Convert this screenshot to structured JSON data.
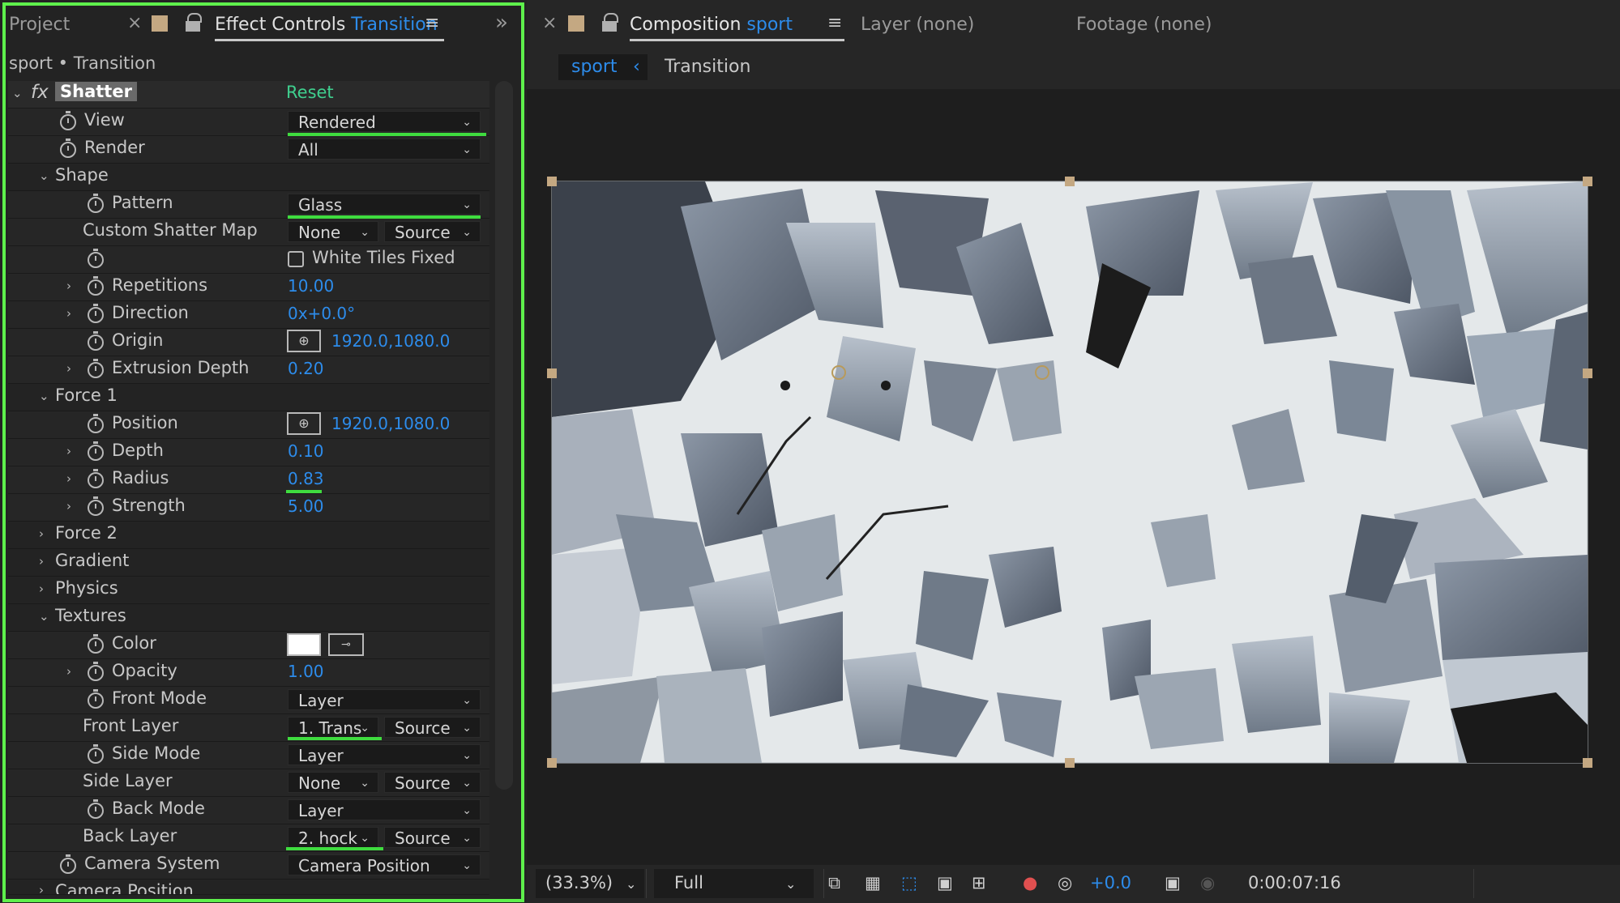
{
  "panel_tabs": {
    "project": "Project",
    "effect_controls_prefix": "Effect Controls",
    "effect_controls_layer": "Transition",
    "overflow": "»"
  },
  "breadcrumb": "sport • Transition",
  "effect": {
    "fx": "fx",
    "name": "Shatter",
    "reset": "Reset"
  },
  "props": {
    "view": {
      "label": "View",
      "value": "Rendered"
    },
    "render": {
      "label": "Render",
      "value": "All"
    },
    "shape": {
      "label": "Shape"
    },
    "pattern": {
      "label": "Pattern",
      "value": "Glass"
    },
    "custom_map": {
      "label": "Custom Shatter Map",
      "value": "None",
      "source": "Source"
    },
    "white_tiles": {
      "label": "White Tiles Fixed"
    },
    "repetitions": {
      "label": "Repetitions",
      "value": "10.00"
    },
    "direction": {
      "label": "Direction",
      "value": "0x+0.0°"
    },
    "origin": {
      "label": "Origin",
      "value": "1920.0,1080.0"
    },
    "extrusion": {
      "label": "Extrusion Depth",
      "value": "0.20"
    },
    "force1": {
      "label": "Force 1"
    },
    "position": {
      "label": "Position",
      "value": "1920.0,1080.0"
    },
    "depth": {
      "label": "Depth",
      "value": "0.10"
    },
    "radius": {
      "label": "Radius",
      "value": "0.83"
    },
    "strength": {
      "label": "Strength",
      "value": "5.00"
    },
    "force2": {
      "label": "Force 2"
    },
    "gradient": {
      "label": "Gradient"
    },
    "physics": {
      "label": "Physics"
    },
    "textures": {
      "label": "Textures"
    },
    "color": {
      "label": "Color"
    },
    "opacity": {
      "label": "Opacity",
      "value": "1.00"
    },
    "front_mode": {
      "label": "Front Mode",
      "value": "Layer"
    },
    "front_layer": {
      "label": "Front Layer",
      "value": "1. Trans",
      "source": "Source"
    },
    "side_mode": {
      "label": "Side Mode",
      "value": "Layer"
    },
    "side_layer": {
      "label": "Side Layer",
      "value": "None",
      "source": "Source"
    },
    "back_mode": {
      "label": "Back Mode",
      "value": "Layer"
    },
    "back_layer": {
      "label": "Back Layer",
      "value": "2. hock",
      "source": "Source"
    },
    "camera_system": {
      "label": "Camera System",
      "value": "Camera Position"
    },
    "camera_position": {
      "label": "Camera Position"
    }
  },
  "comp": {
    "tab_prefix": "Composition",
    "tab_name": "sport",
    "layer_tab": "Layer (none)",
    "footage_tab": "Footage (none)",
    "crumb_active": "sport",
    "crumb_next": "Transition"
  },
  "viewer_bar": {
    "zoom": "(33.3%)",
    "resolution": "Full",
    "exposure": "+0.0",
    "timecode": "0:00:07:16"
  },
  "colors": {
    "accent_blue": "#2d8ceb",
    "highlight_green": "#5ef04c",
    "reset_green": "#3fcf8e"
  }
}
